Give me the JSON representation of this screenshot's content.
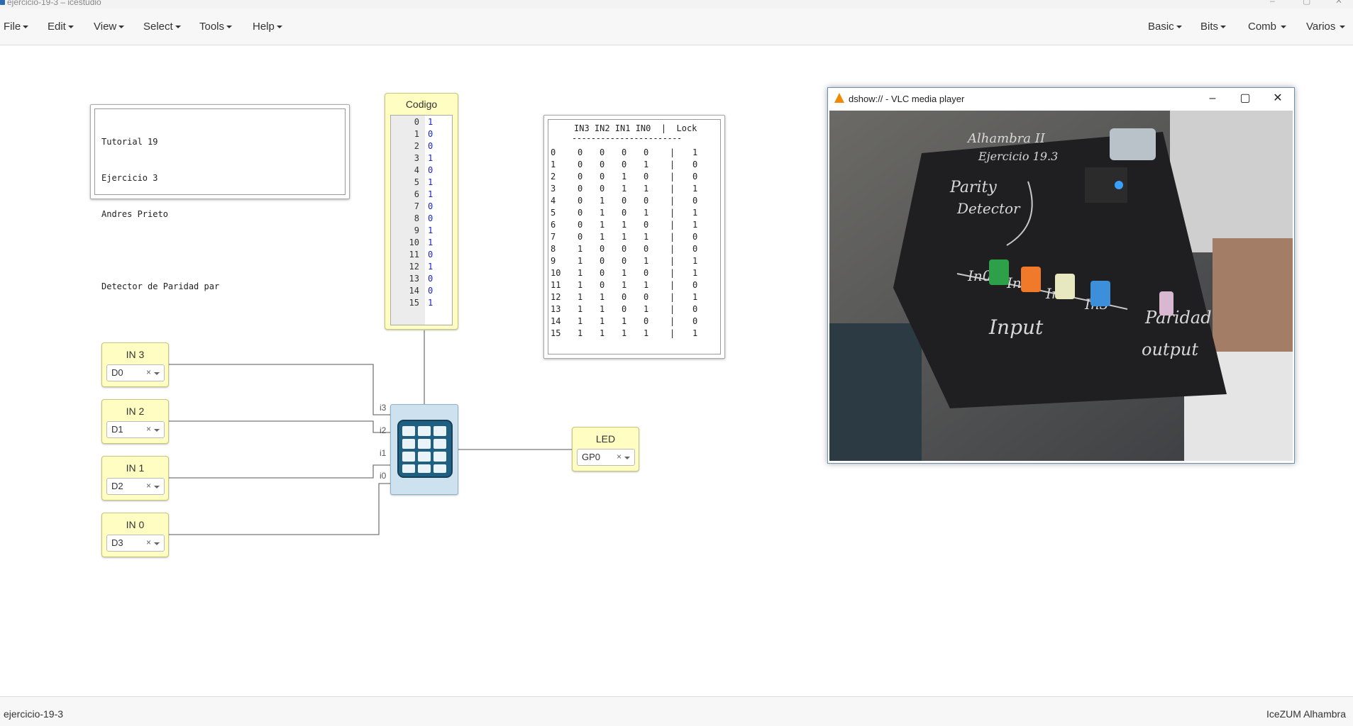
{
  "window": {
    "title": "ejercicio-19-3 – icestudio",
    "controls": [
      "–",
      "▢",
      "✕"
    ]
  },
  "menubar": {
    "left": [
      "File",
      "Edit",
      "View",
      "Select",
      "Tools",
      "Help"
    ],
    "right": [
      "Basic",
      "Bits",
      "Comb",
      "Varios"
    ]
  },
  "comment": {
    "lines": [
      "Tutorial 19",
      "Ejercicio 3",
      "Andres Prieto",
      "",
      "Detector de Paridad par"
    ]
  },
  "codigo": {
    "title": "Codigo",
    "rows": [
      {
        "n": "0",
        "v": "1"
      },
      {
        "n": "1",
        "v": "0"
      },
      {
        "n": "2",
        "v": "0"
      },
      {
        "n": "3",
        "v": "1"
      },
      {
        "n": "4",
        "v": "0"
      },
      {
        "n": "5",
        "v": "1"
      },
      {
        "n": "6",
        "v": "1"
      },
      {
        "n": "7",
        "v": "0"
      },
      {
        "n": "8",
        "v": "0"
      },
      {
        "n": "9",
        "v": "1"
      },
      {
        "n": "10",
        "v": "1"
      },
      {
        "n": "11",
        "v": "0"
      },
      {
        "n": "12",
        "v": "1"
      },
      {
        "n": "13",
        "v": "0"
      },
      {
        "n": "14",
        "v": "0"
      },
      {
        "n": "15",
        "v": "1"
      }
    ]
  },
  "truth_table": {
    "header": "IN3 IN2 IN1 IN0  |  Lock",
    "separator": "-----------------------",
    "rows": [
      [
        "0",
        "0",
        "0",
        "0",
        "0",
        "1"
      ],
      [
        "1",
        "0",
        "0",
        "0",
        "1",
        "0"
      ],
      [
        "2",
        "0",
        "0",
        "1",
        "0",
        "0"
      ],
      [
        "3",
        "0",
        "0",
        "1",
        "1",
        "1"
      ],
      [
        "4",
        "0",
        "1",
        "0",
        "0",
        "0"
      ],
      [
        "5",
        "0",
        "1",
        "0",
        "1",
        "1"
      ],
      [
        "6",
        "0",
        "1",
        "1",
        "0",
        "1"
      ],
      [
        "7",
        "0",
        "1",
        "1",
        "1",
        "0"
      ],
      [
        "8",
        "1",
        "0",
        "0",
        "0",
        "0"
      ],
      [
        "9",
        "1",
        "0",
        "0",
        "1",
        "1"
      ],
      [
        "10",
        "1",
        "0",
        "1",
        "0",
        "1"
      ],
      [
        "11",
        "1",
        "0",
        "1",
        "1",
        "0"
      ],
      [
        "12",
        "1",
        "1",
        "0",
        "0",
        "1"
      ],
      [
        "13",
        "1",
        "1",
        "0",
        "1",
        "0"
      ],
      [
        "14",
        "1",
        "1",
        "1",
        "0",
        "0"
      ],
      [
        "15",
        "1",
        "1",
        "1",
        "1",
        "1"
      ]
    ],
    "bar": "|"
  },
  "inputs": [
    {
      "label": "IN 3",
      "pin": "D0",
      "port": "i3"
    },
    {
      "label": "IN 2",
      "pin": "D1",
      "port": "i2"
    },
    {
      "label": "IN 1",
      "pin": "D2",
      "port": "i1"
    },
    {
      "label": "IN 0",
      "pin": "D3",
      "port": "i0"
    }
  ],
  "output": {
    "label": "LED",
    "pin": "GP0"
  },
  "clear_glyph": "×",
  "vlc": {
    "title": "dshow:// - VLC media player",
    "board_labels": [
      "Alhambra II",
      "Ejercicio 19.3",
      "Parity",
      "Detector",
      "In0",
      "In1",
      "In2",
      "In3",
      "Input",
      "Paridad",
      "output"
    ]
  },
  "statusbar": {
    "file": "ejercicio-19-3",
    "board": "IceZUM Alhambra"
  }
}
